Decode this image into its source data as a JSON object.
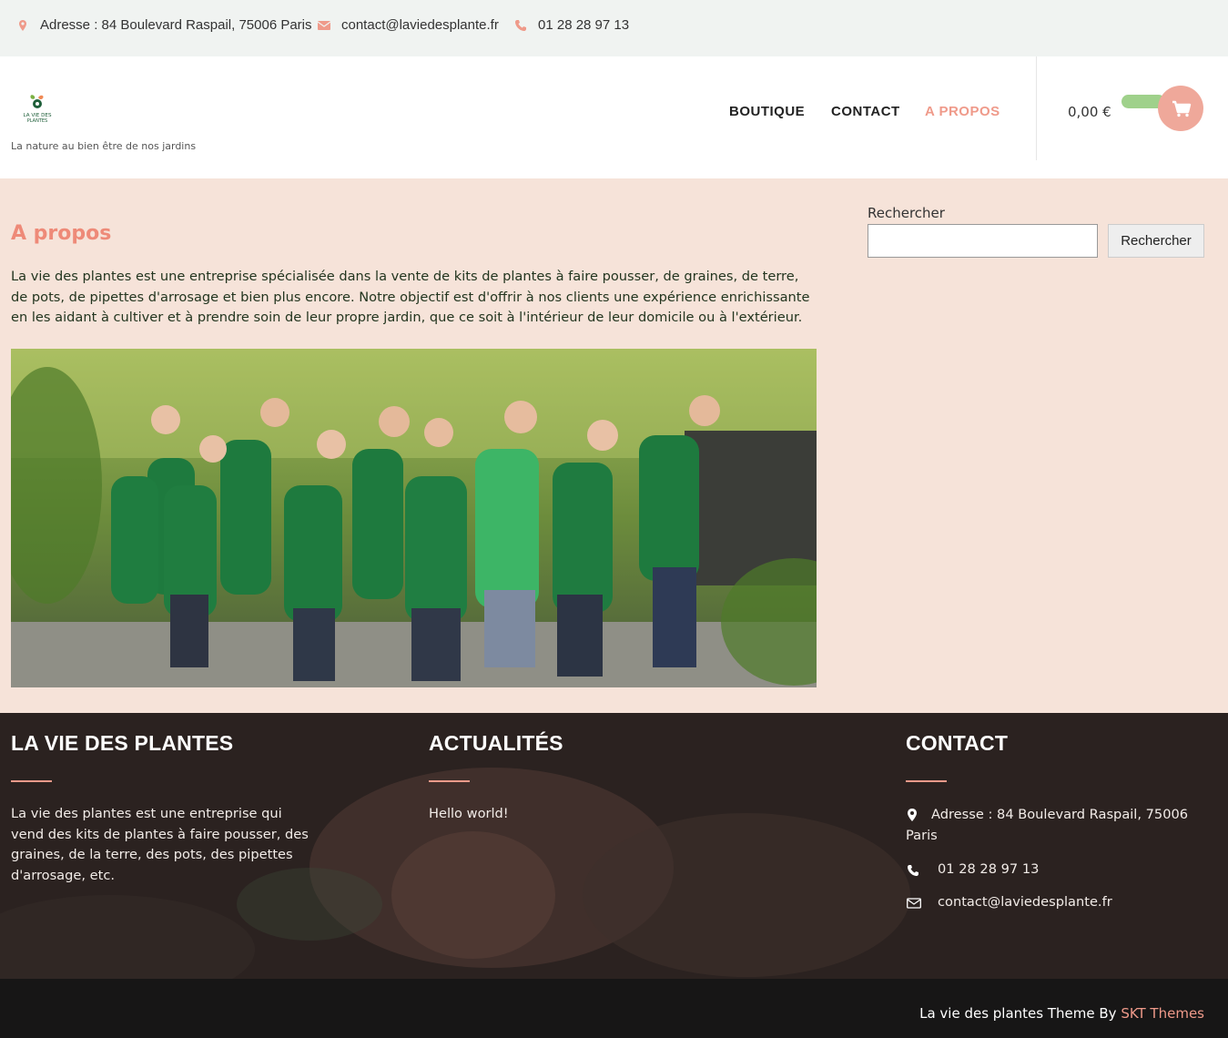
{
  "topbar": {
    "address": "Adresse : 84 Boulevard Raspail, 75006 Paris",
    "email": "contact@laviedesplante.fr",
    "phone": "01 28 28 97 13"
  },
  "header": {
    "logo_text": "LA VIE DES PLANTES",
    "tagline": "La nature au bien être de nos jardins",
    "nav": [
      "BOUTIQUE",
      "CONTACT",
      "A PROPOS"
    ],
    "cart_total": "0,00 €"
  },
  "main": {
    "title": "A propos",
    "text": "La vie des plantes est une entreprise spécialisée dans la vente de kits de plantes à faire pousser, de graines, de terre, de pots, de pipettes d'arrosage et bien plus encore. Notre objectif est d'offrir à nos clients une expérience enrichissante en les aidant à cultiver et à prendre soin de leur propre jardin, que ce soit à l'intérieur de leur domicile ou à l'extérieur."
  },
  "search": {
    "label": "Rechercher",
    "button": "Rechercher",
    "value": ""
  },
  "footer": {
    "col1": {
      "heading": "LA VIE DES PLANTES",
      "text": "La vie des plantes est une entreprise qui vend des kits de plantes à faire pousser, des graines, de la terre, des pots, des pipettes d'arrosage, etc."
    },
    "col2": {
      "heading": "ACTUALITÉS",
      "post": "Hello world!"
    },
    "col3": {
      "heading": "CONTACT",
      "address": "Adresse : 84 Boulevard Raspail, 75006 Paris",
      "phone": "01 28 28 97 13",
      "email": "contact@laviedesplante.fr"
    }
  },
  "credit": {
    "text": "La vie des plantes Theme By ",
    "link": "SKT Themes"
  },
  "colors": {
    "accent": "#ef9a8a",
    "main_bg": "#f6e3d9",
    "footer_bg": "#2a2321",
    "cart_pill": "#9fd18b"
  }
}
